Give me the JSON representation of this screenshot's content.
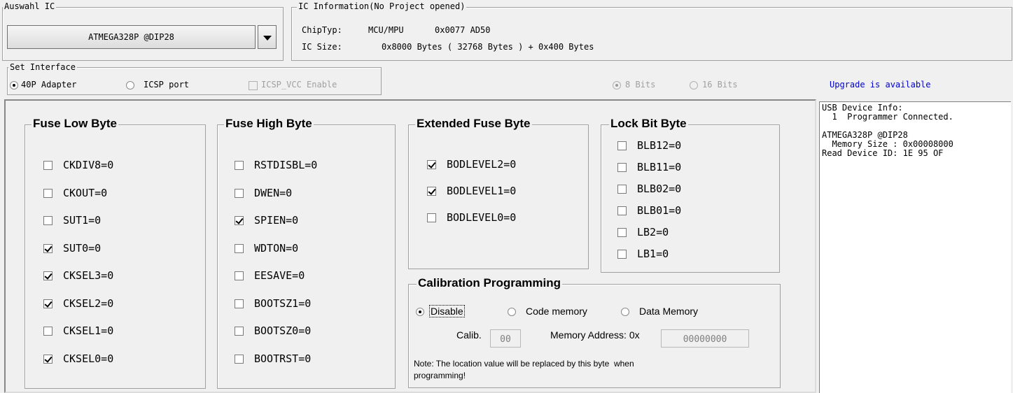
{
  "auswahl": {
    "legend": "Auswahl IC",
    "selected_chip": "ATMEGA328P @DIP28"
  },
  "ic_info": {
    "legend": "IC Information(No Project opened)",
    "chip_type_label": "ChipTyp:",
    "chip_type_value": "MCU/MPU",
    "chip_id": "0x0077 AD50",
    "ic_size_label": "IC Size:",
    "ic_size_value": "0x8000 Bytes ( 32768 Bytes ) + 0x400 Bytes"
  },
  "interface": {
    "legend": "Set Interface",
    "opt_40p": "40P Adapter",
    "opt_icsp": "ICSP port",
    "icsp_vcc": "ICSP_VCC Enable",
    "bits8": "8 Bits",
    "bits16": "16 Bits"
  },
  "upgrade_link": "Upgrade is available",
  "fuse_low": {
    "legend": "Fuse Low Byte",
    "items": [
      {
        "label": "CKDIV8=0",
        "checked": false
      },
      {
        "label": "CKOUT=0",
        "checked": false
      },
      {
        "label": "SUT1=0",
        "checked": false
      },
      {
        "label": "SUT0=0",
        "checked": true
      },
      {
        "label": "CKSEL3=0",
        "checked": true
      },
      {
        "label": "CKSEL2=0",
        "checked": true
      },
      {
        "label": "CKSEL1=0",
        "checked": false
      },
      {
        "label": "CKSEL0=0",
        "checked": true
      }
    ]
  },
  "fuse_high": {
    "legend": "Fuse High Byte",
    "items": [
      {
        "label": "RSTDISBL=0",
        "checked": false
      },
      {
        "label": "DWEN=0",
        "checked": false
      },
      {
        "label": "SPIEN=0",
        "checked": true
      },
      {
        "label": "WDTON=0",
        "checked": false
      },
      {
        "label": "EESAVE=0",
        "checked": false
      },
      {
        "label": "BOOTSZ1=0",
        "checked": false
      },
      {
        "label": "BOOTSZ0=0",
        "checked": false
      },
      {
        "label": "BOOTRST=0",
        "checked": false
      }
    ]
  },
  "ext_fuse": {
    "legend": "Extended Fuse Byte",
    "items": [
      {
        "label": "BODLEVEL2=0",
        "checked": true
      },
      {
        "label": "BODLEVEL1=0",
        "checked": true
      },
      {
        "label": "BODLEVEL0=0",
        "checked": false
      }
    ]
  },
  "lock_bits": {
    "legend": "Lock Bit Byte",
    "items": [
      {
        "label": "BLB12=0",
        "checked": false
      },
      {
        "label": "BLB11=0",
        "checked": false
      },
      {
        "label": "BLB02=0",
        "checked": false
      },
      {
        "label": "BLB01=0",
        "checked": false
      },
      {
        "label": "LB2=0",
        "checked": false
      },
      {
        "label": "LB1=0",
        "checked": false
      }
    ]
  },
  "calibration": {
    "legend": "Calibration Programming",
    "opt_disable": "Disable",
    "opt_code": "Code memory",
    "opt_data": "Data Memory",
    "calib_label": "Calib.",
    "calib_value": "00",
    "mem_addr_label": "Memory Address: 0x",
    "mem_addr_value": "00000000",
    "note_line1": "Note: The location value will be replaced by this byte  when",
    "note_line2": "programming!"
  },
  "log": {
    "lines": [
      "USB Device Info:",
      "  1  Programmer Connected.",
      "",
      "ATMEGA328P @DIP28",
      "  Memory Size : 0x00008000",
      "Read Device ID: 1E 95 OF"
    ]
  }
}
